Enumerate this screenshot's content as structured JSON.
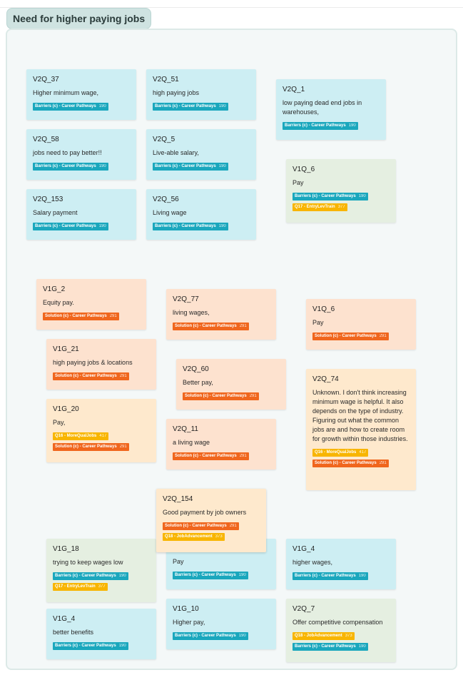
{
  "page_title": "Need for higher paying jobs",
  "cards": [
    {
      "id": "V2Q_37",
      "text": "Higher minimum wage,",
      "tags": [
        {
          "label": "Barriers (c) - Career Pathways",
          "count": "190"
        }
      ]
    },
    {
      "id": "V2Q_51",
      "text": "high paying jobs",
      "tags": [
        {
          "label": "Barriers (c) - Career Pathways",
          "count": "190"
        }
      ]
    },
    {
      "id": "V2Q_1",
      "text": "low paying dead end jobs in warehouses,",
      "tags": [
        {
          "label": "Barriers (c) - Career Pathways",
          "count": "190"
        }
      ]
    },
    {
      "id": "V2Q_58",
      "text": "jobs need to pay better!!",
      "tags": [
        {
          "label": "Barriers (c) - Career Pathways",
          "count": "190"
        }
      ]
    },
    {
      "id": "V2Q_5",
      "text": "Live-able salary,",
      "tags": [
        {
          "label": "Barriers (c) - Career Pathways",
          "count": "190"
        }
      ]
    },
    {
      "id": "V1Q_6",
      "text": "Pay",
      "tags": [
        {
          "label": "Barriers (c) - Career Pathways",
          "count": "190"
        },
        {
          "label": "Q17 - EntryLevTrain",
          "count": "377"
        }
      ]
    },
    {
      "id": "V2Q_153",
      "text": "Salary payment",
      "tags": [
        {
          "label": "Barriers (c) - Career Pathways",
          "count": "190"
        }
      ]
    },
    {
      "id": "V2Q_56",
      "text": "Living wage",
      "tags": [
        {
          "label": "Barriers (c) - Career Pathways",
          "count": "190"
        }
      ]
    },
    {
      "id": "V1G_2",
      "text": "Equity pay.",
      "tags": [
        {
          "label": "Solution (c) - Career Pathways",
          "count": "291"
        }
      ]
    },
    {
      "id": "V2Q_77",
      "text": "living wages,",
      "tags": [
        {
          "label": "Solution (c) - Career Pathways",
          "count": "291"
        }
      ]
    },
    {
      "id": "V1Q_6",
      "text": "Pay",
      "tags": [
        {
          "label": "Solution (c) - Career Pathways",
          "count": "291"
        }
      ]
    },
    {
      "id": "V1G_21",
      "text": "high paying jobs & locations",
      "tags": [
        {
          "label": "Solution (c) - Career Pathways",
          "count": "291"
        }
      ]
    },
    {
      "id": "V2Q_60",
      "text": "Better pay,",
      "tags": [
        {
          "label": "Solution (c) - Career Pathways",
          "count": "291"
        }
      ]
    },
    {
      "id": "V2Q_74",
      "text": "Unknown. I don't think increasing minimum wage is helpful. It also depends on the type of industry. Figuring out what the common jobs are and how to create room for growth within those industries.",
      "tags": [
        {
          "label": "Q16 - MoreQualJobs",
          "count": "417"
        },
        {
          "label": "Solution (c) - Career Pathways",
          "count": "291"
        }
      ]
    },
    {
      "id": "V1G_20",
      "text": "Pay,",
      "tags": [
        {
          "label": "Q16 - MoreQualJobs",
          "count": "417"
        },
        {
          "label": "Solution (c) - Career Pathways",
          "count": "291"
        }
      ]
    },
    {
      "id": "V2Q_11",
      "text": "a living wage",
      "tags": [
        {
          "label": "Solution (c) - Career Pathways",
          "count": "291"
        }
      ]
    },
    {
      "id": "",
      "text": "Pay",
      "tags": [
        {
          "label": "Barriers (c) - Career Pathways",
          "count": "190"
        }
      ]
    },
    {
      "id": "V2Q_154",
      "text": "Good payment by job owners",
      "tags": [
        {
          "label": "Solution (c) - Career Pathways",
          "count": "291"
        },
        {
          "label": "Q18 - JobAdvancement",
          "count": "373"
        }
      ]
    },
    {
      "id": "V1G_18",
      "text": "trying to keep wages low",
      "tags": [
        {
          "label": "Barriers (c) - Career Pathways",
          "count": "190"
        },
        {
          "label": "Q17 - EntryLevTrain",
          "count": "377"
        }
      ]
    },
    {
      "id": "V1G_4",
      "text": "higher wages,",
      "tags": [
        {
          "label": "Barriers (c) - Career Pathways",
          "count": "190"
        }
      ]
    },
    {
      "id": "V1G_4",
      "text": "better benefits",
      "tags": [
        {
          "label": "Barriers (c) - Career Pathways",
          "count": "190"
        }
      ]
    },
    {
      "id": "V1G_10",
      "text": "Higher pay,",
      "tags": [
        {
          "label": "Barriers (c) - Career Pathways",
          "count": "190"
        }
      ]
    },
    {
      "id": "V2Q_7",
      "text": "Offer competitive compensation",
      "tags": [
        {
          "label": "Q18 - JobAdvancement",
          "count": "373"
        },
        {
          "label": "Barriers (c) - Career Pathways",
          "count": "190"
        }
      ]
    }
  ]
}
